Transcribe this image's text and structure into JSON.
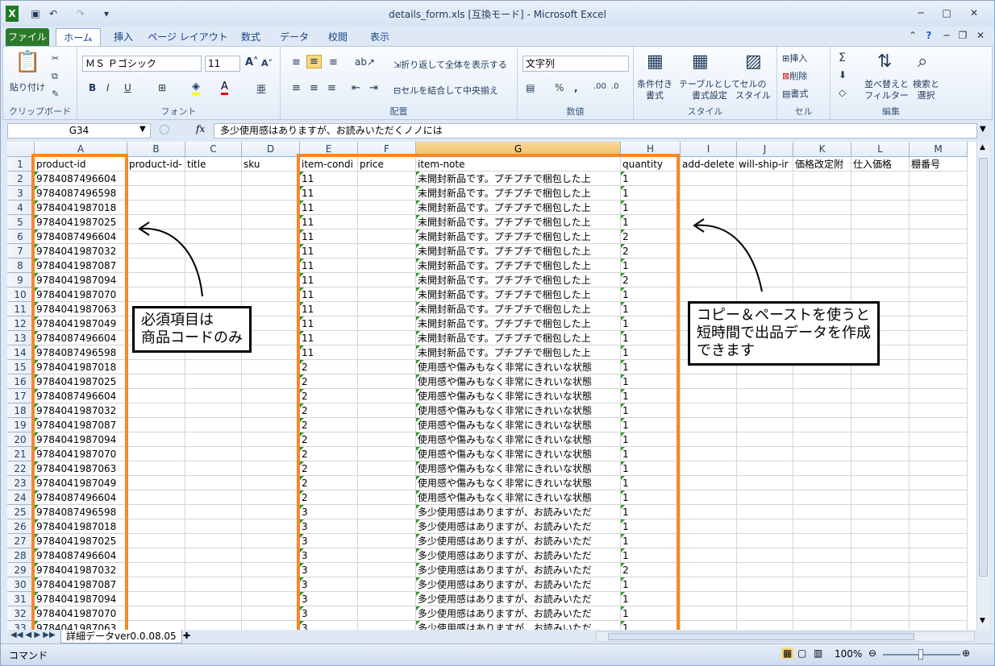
{
  "window": {
    "title": "details_form.xls  [互換モード] - Microsoft Excel"
  },
  "tabs": [
    "ファイル",
    "ホーム",
    "挿入",
    "ページ レイアウト",
    "数式",
    "データ",
    "校閲",
    "表示"
  ],
  "ribbon": {
    "clipboard": {
      "paste": "貼り付け",
      "label": "クリップボード"
    },
    "font": {
      "name": "ＭＳ Ｐゴシック",
      "size": "11",
      "label": "フォント"
    },
    "alignment": {
      "wrap": "折り返して全体を表示する",
      "merge": "セルを結合して中央揃え",
      "label": "配置"
    },
    "number": {
      "format": "文字列",
      "label": "数値"
    },
    "styles": {
      "cond": "条件付き\n書式",
      "table": "テーブルとして\n書式設定",
      "cell": "セルの\nスタイル",
      "label": "スタイル"
    },
    "cells": {
      "insert": "挿入",
      "delete": "削除",
      "format": "書式",
      "label": "セル"
    },
    "editing": {
      "sort": "並べ替えと\nフィルター",
      "find": "検索と\n選択",
      "label": "編集"
    }
  },
  "formula": {
    "namebox": "G34",
    "fx": "fx",
    "content": "多少使用感はありますが、お読みいただくノノには"
  },
  "columns": [
    "A",
    "B",
    "C",
    "D",
    "E",
    "F",
    "G",
    "H",
    "I",
    "J",
    "K",
    "L",
    "M"
  ],
  "headers": [
    "product-id",
    "product-id-",
    "title",
    "sku",
    "item-condi",
    "price",
    "item-note",
    "quantity",
    "add-delete",
    "will-ship-ir",
    "価格改定附",
    "仕入価格",
    "棚番号"
  ],
  "rows": [
    [
      "9784087496604",
      "11",
      "未開封新品です。プチプチで梱包した上",
      "1"
    ],
    [
      "9784087496598",
      "11",
      "未開封新品です。プチプチで梱包した上",
      "1"
    ],
    [
      "9784041987018",
      "11",
      "未開封新品です。プチプチで梱包した上",
      "1"
    ],
    [
      "9784041987025",
      "11",
      "未開封新品です。プチプチで梱包した上",
      "1"
    ],
    [
      "9784087496604",
      "11",
      "未開封新品です。プチプチで梱包した上",
      "2"
    ],
    [
      "9784041987032",
      "11",
      "未開封新品です。プチプチで梱包した上",
      "2"
    ],
    [
      "9784041987087",
      "11",
      "未開封新品です。プチプチで梱包した上",
      "1"
    ],
    [
      "9784041987094",
      "11",
      "未開封新品です。プチプチで梱包した上",
      "2"
    ],
    [
      "9784041987070",
      "11",
      "未開封新品です。プチプチで梱包した上",
      "1"
    ],
    [
      "9784041987063",
      "11",
      "未開封新品です。プチプチで梱包した上",
      "1"
    ],
    [
      "9784041987049",
      "11",
      "未開封新品です。プチプチで梱包した上",
      "1"
    ],
    [
      "9784087496604",
      "11",
      "未開封新品です。プチプチで梱包した上",
      "1"
    ],
    [
      "9784087496598",
      "11",
      "未開封新品です。プチプチで梱包した上",
      "1"
    ],
    [
      "9784041987018",
      "2",
      "使用感や傷みもなく非常にきれいな状態",
      "1"
    ],
    [
      "9784041987025",
      "2",
      "使用感や傷みもなく非常にきれいな状態",
      "1"
    ],
    [
      "9784087496604",
      "2",
      "使用感や傷みもなく非常にきれいな状態",
      "1"
    ],
    [
      "9784041987032",
      "2",
      "使用感や傷みもなく非常にきれいな状態",
      "1"
    ],
    [
      "9784041987087",
      "2",
      "使用感や傷みもなく非常にきれいな状態",
      "1"
    ],
    [
      "9784041987094",
      "2",
      "使用感や傷みもなく非常にきれいな状態",
      "1"
    ],
    [
      "9784041987070",
      "2",
      "使用感や傷みもなく非常にきれいな状態",
      "1"
    ],
    [
      "9784041987063",
      "2",
      "使用感や傷みもなく非常にきれいな状態",
      "1"
    ],
    [
      "9784041987049",
      "2",
      "使用感や傷みもなく非常にきれいな状態",
      "1"
    ],
    [
      "9784087496604",
      "2",
      "使用感や傷みもなく非常にきれいな状態",
      "1"
    ],
    [
      "9784087496598",
      "3",
      "多少使用感はありますが、お読みいただ",
      "1"
    ],
    [
      "9784041987018",
      "3",
      "多少使用感はありますが、お読みいただ",
      "1"
    ],
    [
      "9784041987025",
      "3",
      "多少使用感はありますが、お読みいただ",
      "1"
    ],
    [
      "9784087496604",
      "3",
      "多少使用感はありますが、お読みいただ",
      "1"
    ],
    [
      "9784041987032",
      "3",
      "多少使用感はありますが、お読みいただ",
      "2"
    ],
    [
      "9784041987087",
      "3",
      "多少使用感はありますが、お読みいただ",
      "1"
    ],
    [
      "9784041987094",
      "3",
      "多少使用感はありますが、お読みいただ",
      "1"
    ],
    [
      "9784041987070",
      "3",
      "多少使用感はありますが、お読みいただ",
      "1"
    ],
    [
      "9784041987063",
      "3",
      "多少使用感はありますが、お読みいただ",
      "1"
    ]
  ],
  "callouts": {
    "left": [
      "必須項目は",
      "商品コードのみ"
    ],
    "right": [
      "コピー＆ペーストを使うと",
      "短時間で出品データを作成",
      "できます"
    ]
  },
  "sheet_tab": "詳細データver0.0.08.05",
  "status": {
    "mode": "コマンド",
    "zoom": "100%"
  },
  "colors": {
    "highlight": "#f6872a",
    "file_tab": "#2a7a2a"
  }
}
